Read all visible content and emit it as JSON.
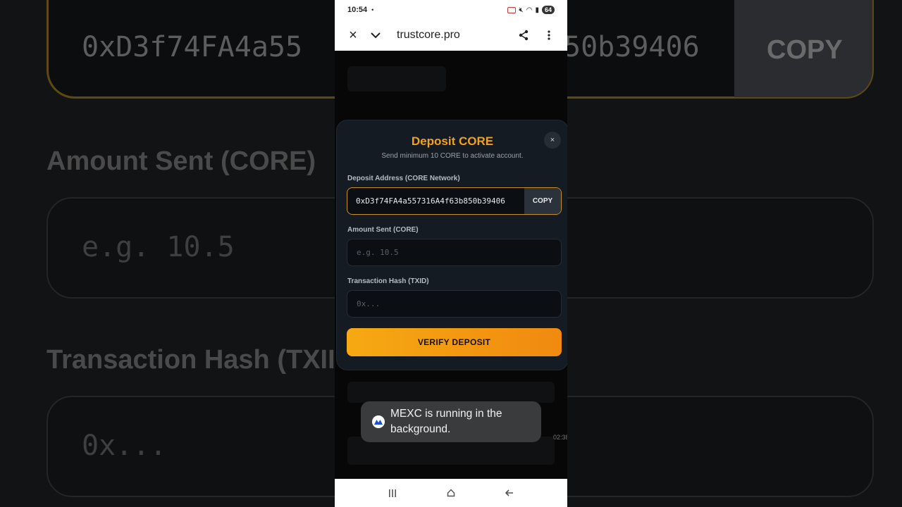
{
  "background": {
    "address_preview": "0xD3f74FA4a55",
    "address_tail": "50b39406",
    "copy_label": "COPY",
    "amount_label": "Amount Sent (CORE)",
    "amount_placeholder": "e.g. 10.5",
    "txid_label": "Transaction Hash (TXII",
    "txid_placeholder": "0x..."
  },
  "status_bar": {
    "time": "10:54",
    "dot": "•",
    "battery": "64"
  },
  "browser": {
    "close_icon": "×",
    "menu_chevron": "⌄",
    "url": "trustcore.pro"
  },
  "modal": {
    "title": "Deposit CORE",
    "subtitle": "Send minimum 10 CORE to activate account.",
    "close_icon": "×",
    "address_label": "Deposit Address (CORE Network)",
    "address_value": "0xD3f74FA4a557316A4f63b850b39406",
    "copy_label": "COPY",
    "amount_label": "Amount Sent (CORE)",
    "amount_placeholder": "e.g. 10.5",
    "txid_label": "Transaction Hash (TXID)",
    "txid_placeholder": "0x...",
    "verify_label": "VERIFY DEPOSIT"
  },
  "toast": {
    "message": "MEXC is running in the background."
  },
  "timecode": "02:38",
  "nav": {
    "recents": "|||",
    "home": "⌂",
    "back": "←"
  },
  "colors": {
    "accent": "#f4a11a",
    "button_gradient_start": "#f6a912",
    "button_gradient_end": "#f08a10",
    "modal_bg": "#151b22"
  }
}
